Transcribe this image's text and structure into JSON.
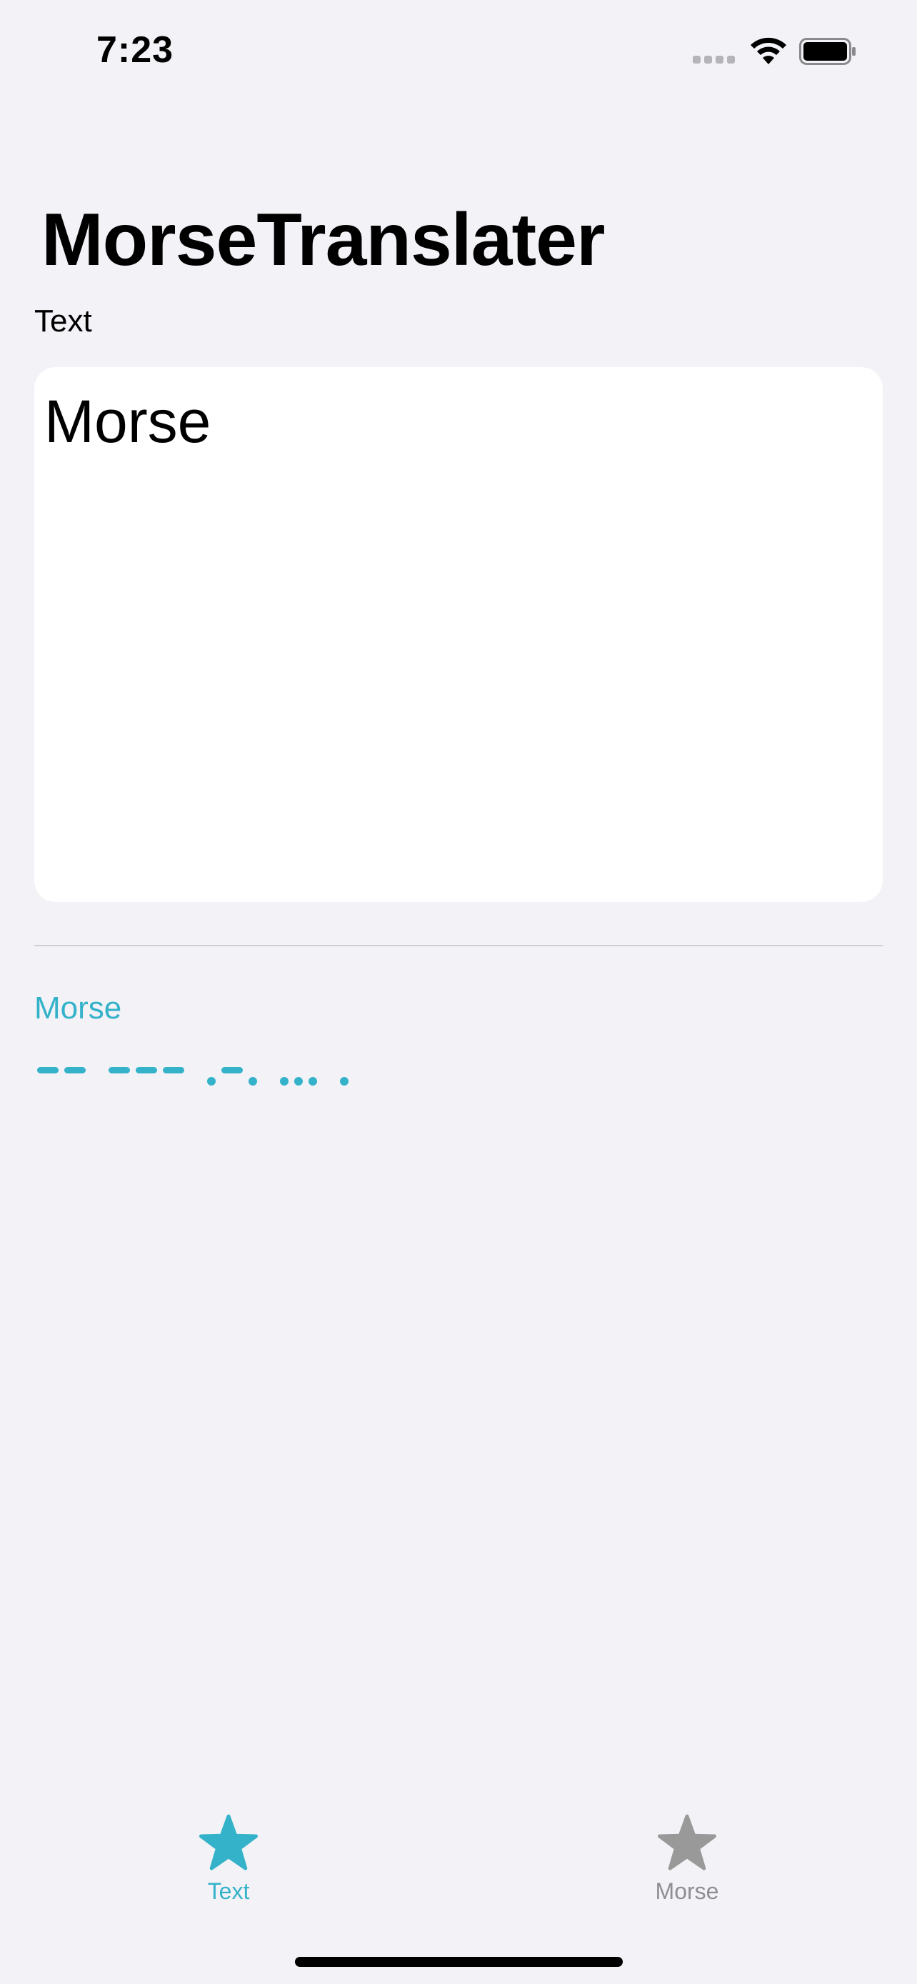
{
  "status_bar": {
    "time": "7:23"
  },
  "header": {
    "title": "MorseTranslater"
  },
  "text_section": {
    "label": "Text",
    "editor_value": "Morse"
  },
  "morse_section": {
    "label": "Morse",
    "output": "-- --- .-. ... ."
  },
  "tab_bar": {
    "tabs": [
      {
        "label": "Text",
        "icon": "star-icon",
        "selected": true
      },
      {
        "label": "Morse",
        "icon": "star-icon",
        "selected": false
      }
    ]
  },
  "colors": {
    "accent": "#34b2c9",
    "background": "#f2f2f7",
    "inactive": "#8e8e93"
  }
}
